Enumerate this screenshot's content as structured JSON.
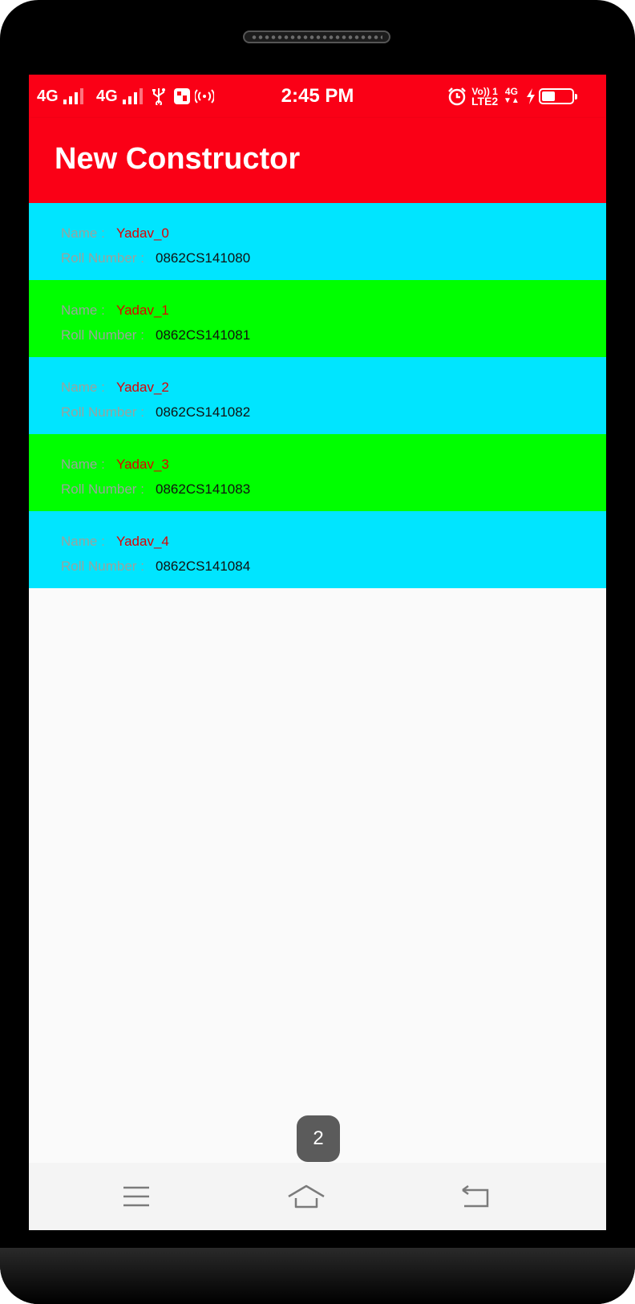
{
  "status_bar": {
    "network_1": "4G",
    "network_2": "4G",
    "time": "2:45 PM",
    "volte_line": "Vo)) 1",
    "lte_line": "LTE2",
    "net_4g": "4G",
    "icons": [
      "signal-icon",
      "usb-icon",
      "notification-icon",
      "hotspot-icon",
      "alarm-icon",
      "charging-icon",
      "battery-icon"
    ],
    "battery_level": 0.45
  },
  "app_bar": {
    "title": "New Constructor"
  },
  "list": {
    "name_label": "Name :",
    "roll_label": "Roll Number :",
    "items": [
      {
        "name": "Yadav_0",
        "roll": "0862CS141080"
      },
      {
        "name": "Yadav_1",
        "roll": "0862CS141081"
      },
      {
        "name": "Yadav_2",
        "roll": "0862CS141082"
      },
      {
        "name": "Yadav_3",
        "roll": "0862CS141083"
      },
      {
        "name": "Yadav_4",
        "roll": "0862CS141084"
      }
    ]
  },
  "toast": {
    "text": "2"
  },
  "colors": {
    "primary": "#fa0016",
    "row_cyan": "#00e5ff",
    "row_green": "#00ff00",
    "name_value": "#e20000",
    "label_gray": "#9aa39d"
  },
  "nav_bar": {
    "icons": [
      "menu-icon",
      "home-icon",
      "back-icon"
    ]
  }
}
